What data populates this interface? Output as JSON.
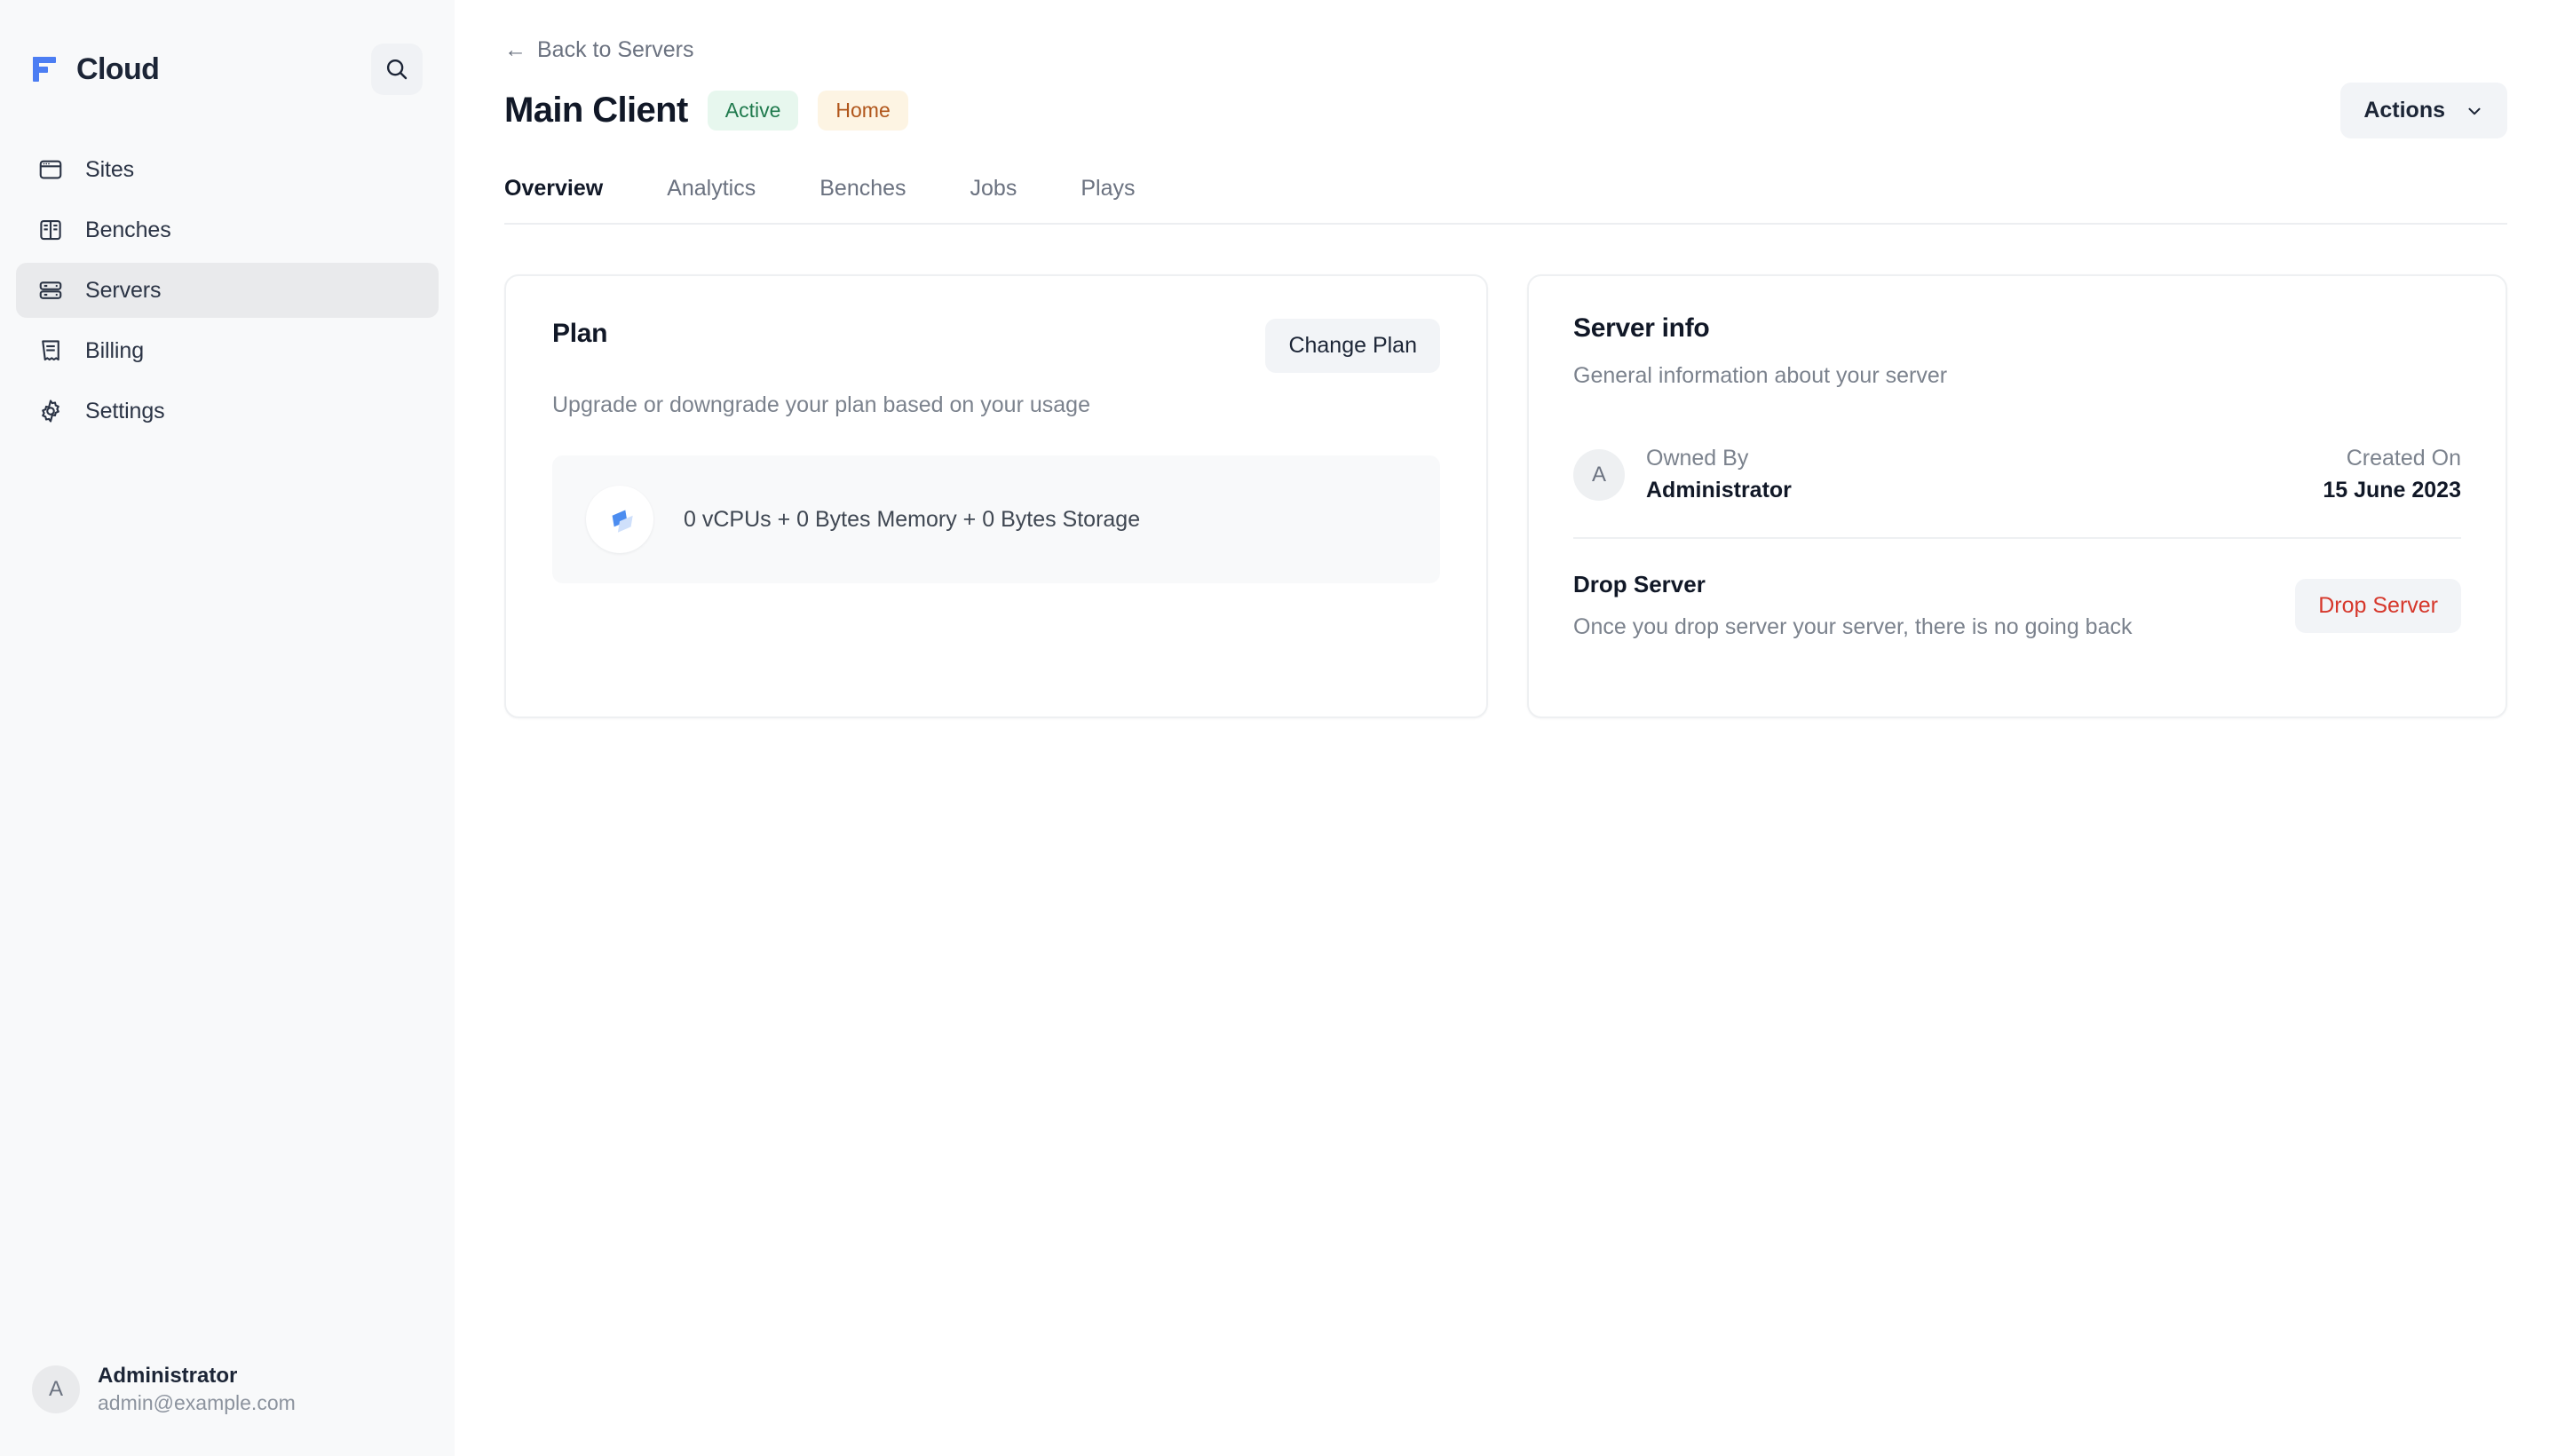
{
  "brand": {
    "name": "Cloud",
    "logo_icon": "frappe-f-logo-icon",
    "accent_color": "#4c7ef3"
  },
  "sidebar": {
    "search_icon": "search-icon",
    "items": [
      {
        "label": "Sites",
        "icon": "browser-window-icon",
        "active": false
      },
      {
        "label": "Benches",
        "icon": "bench-columns-icon",
        "active": false
      },
      {
        "label": "Servers",
        "icon": "server-rack-icon",
        "active": true
      },
      {
        "label": "Billing",
        "icon": "receipt-icon",
        "active": false
      },
      {
        "label": "Settings",
        "icon": "gear-icon",
        "active": false
      }
    ],
    "user": {
      "initial": "A",
      "name": "Administrator",
      "email": "admin@example.com"
    }
  },
  "header": {
    "back_label": "Back to Servers",
    "back_icon": "arrow-left-icon",
    "title": "Main Client",
    "badges": [
      {
        "label": "Active",
        "kind": "status",
        "bg": "#e7f7ee",
        "fg": "#1f7a4d"
      },
      {
        "label": "Home",
        "kind": "region",
        "bg": "#fdf4e3",
        "fg": "#b0551a"
      }
    ],
    "actions_label": "Actions",
    "actions_icon": "chevron-down-icon"
  },
  "tabs": [
    {
      "label": "Overview",
      "active": true
    },
    {
      "label": "Analytics",
      "active": false
    },
    {
      "label": "Benches",
      "active": false
    },
    {
      "label": "Jobs",
      "active": false
    },
    {
      "label": "Plays",
      "active": false
    }
  ],
  "plan_card": {
    "title": "Plan",
    "change_button": "Change Plan",
    "subtitle": "Upgrade or downgrade your plan based on your usage",
    "plan_icon": "plan-blocks-icon",
    "plan_summary": "0 vCPUs + 0 Bytes Memory + 0 Bytes Storage"
  },
  "server_info_card": {
    "title": "Server info",
    "subtitle": "General information about your server",
    "owner": {
      "avatar_initial": "A",
      "label": "Owned By",
      "value": "Administrator"
    },
    "created": {
      "label": "Created On",
      "value": "15 June 2023"
    },
    "drop": {
      "title": "Drop Server",
      "description": "Once you drop server your server, there is no going back",
      "button": "Drop Server",
      "button_color": "#d6372b"
    }
  }
}
